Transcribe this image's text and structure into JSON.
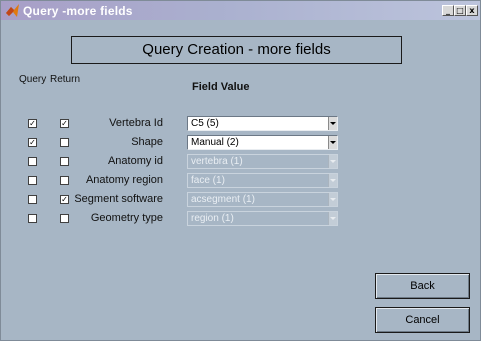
{
  "window": {
    "title": "Query -more fields",
    "controls": {
      "minimize": "_",
      "maximize": "□",
      "close": "x"
    }
  },
  "header": {
    "title": "Query Creation - more fields"
  },
  "columns": {
    "query": "Query",
    "return": "Return",
    "field_value": "Field Value"
  },
  "rows": [
    {
      "label": "Vertebra Id",
      "query": true,
      "return": true,
      "value": "C5 (5)",
      "enabled": true
    },
    {
      "label": "Shape",
      "query": true,
      "return": false,
      "value": "Manual (2)",
      "enabled": true
    },
    {
      "label": "Anatomy id",
      "query": false,
      "return": false,
      "value": "vertebra (1)",
      "enabled": false
    },
    {
      "label": "Anatomy region",
      "query": false,
      "return": false,
      "value": "face (1)",
      "enabled": false
    },
    {
      "label": "Segment software",
      "query": false,
      "return": true,
      "value": "acsegment (1)",
      "enabled": false
    },
    {
      "label": "Geometry type",
      "query": false,
      "return": false,
      "value": "region (1)",
      "enabled": false
    }
  ],
  "buttons": {
    "back": "Back",
    "cancel": "Cancel"
  },
  "colors": {
    "background": "#a7b6c5",
    "title_start": "#a89ec7",
    "title_end": "#bcc4dc"
  },
  "icons": {
    "app": "matlab-logo-icon",
    "check": "checkmark-icon"
  }
}
